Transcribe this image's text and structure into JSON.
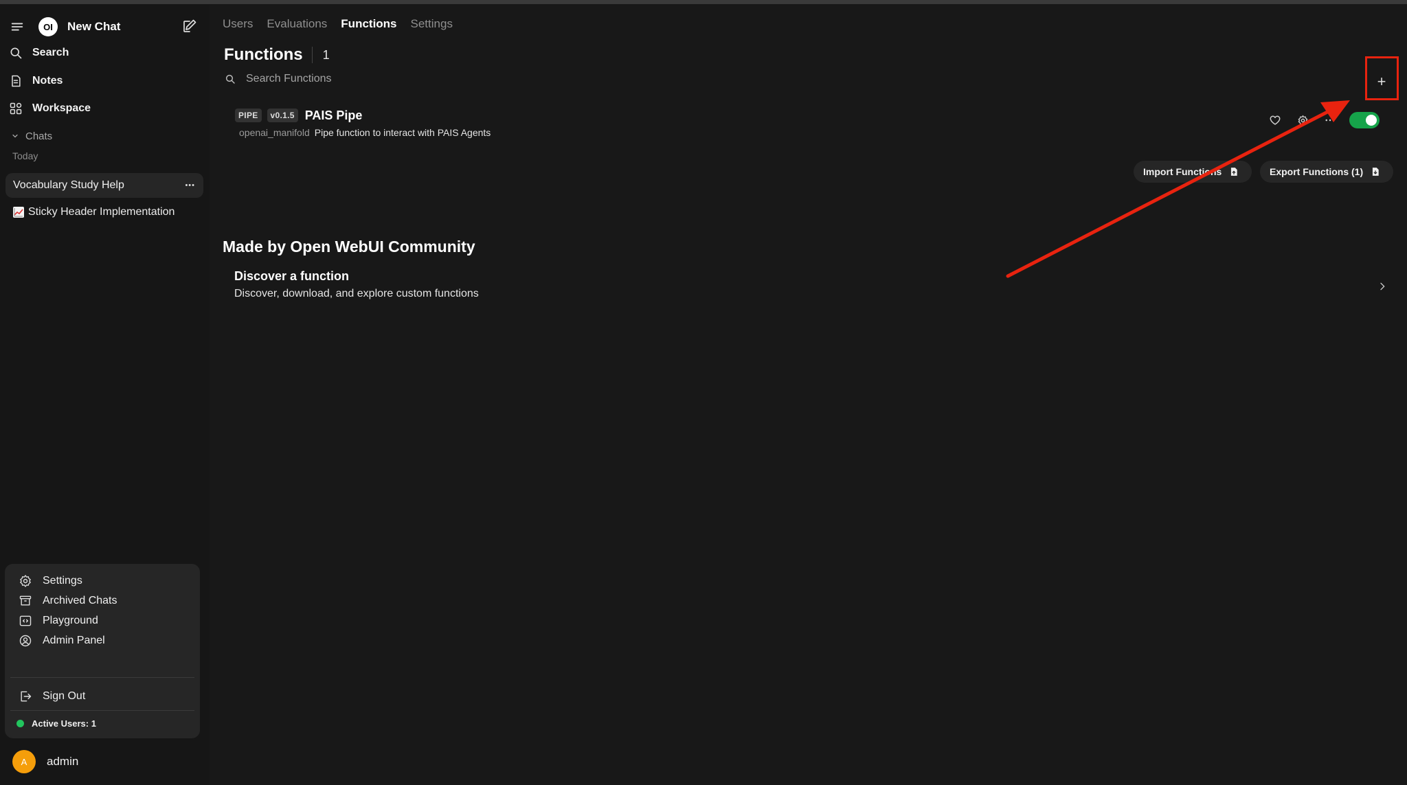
{
  "sidebar": {
    "brand_logo": "OI",
    "brand_label": "New Chat",
    "nav": [
      "Search",
      "Notes",
      "Workspace"
    ],
    "section_label": "Chats",
    "group_label": "Today",
    "chats": [
      "Vocabulary Study Help",
      "Sticky Header Implementation"
    ],
    "chat_more": "•••",
    "user_menu": {
      "items": [
        "Settings",
        "Archived Chats",
        "Playground",
        "Admin Panel"
      ],
      "sign_out": "Sign Out",
      "active_users": "Active Users: 1"
    },
    "account": {
      "initial": "A",
      "name": "admin"
    }
  },
  "main": {
    "tabs": [
      "Users",
      "Evaluations",
      "Functions",
      "Settings"
    ],
    "active_tab": "Functions",
    "title": "Functions",
    "count": "1",
    "search": {
      "placeholder": "Search Functions"
    },
    "add_label": "+",
    "function": {
      "type_badge": "PIPE",
      "version_badge": "v0.1.5",
      "name": "PAIS Pipe",
      "author": "openai_manifold",
      "description": "Pipe function to interact with PAIS Agents",
      "enabled": true
    },
    "import_label": "Import Functions",
    "export_label": "Export Functions (1)",
    "community_heading": "Made by Open WebUI Community",
    "discover": {
      "title": "Discover a function",
      "description": "Discover, download, and explore custom functions"
    }
  },
  "colors": {
    "sidebar_bg": "#161616",
    "main_bg": "#181818",
    "toggle_on": "#16a34a",
    "annotation_red": "#e8230f",
    "avatar": "#f59e0b",
    "status_green": "#22c55e"
  },
  "icons": [
    "menu-icon",
    "compose-icon",
    "search-icon",
    "notes-icon",
    "workspace-icon",
    "chevron-down-icon",
    "more-icon",
    "chart-icon",
    "gear-icon",
    "archive-icon",
    "code-icon",
    "user-circle-icon",
    "sign-out-icon",
    "heart-icon",
    "settings-icon",
    "ellipsis-icon",
    "file-up-icon",
    "file-down-icon",
    "chevron-right-icon"
  ]
}
